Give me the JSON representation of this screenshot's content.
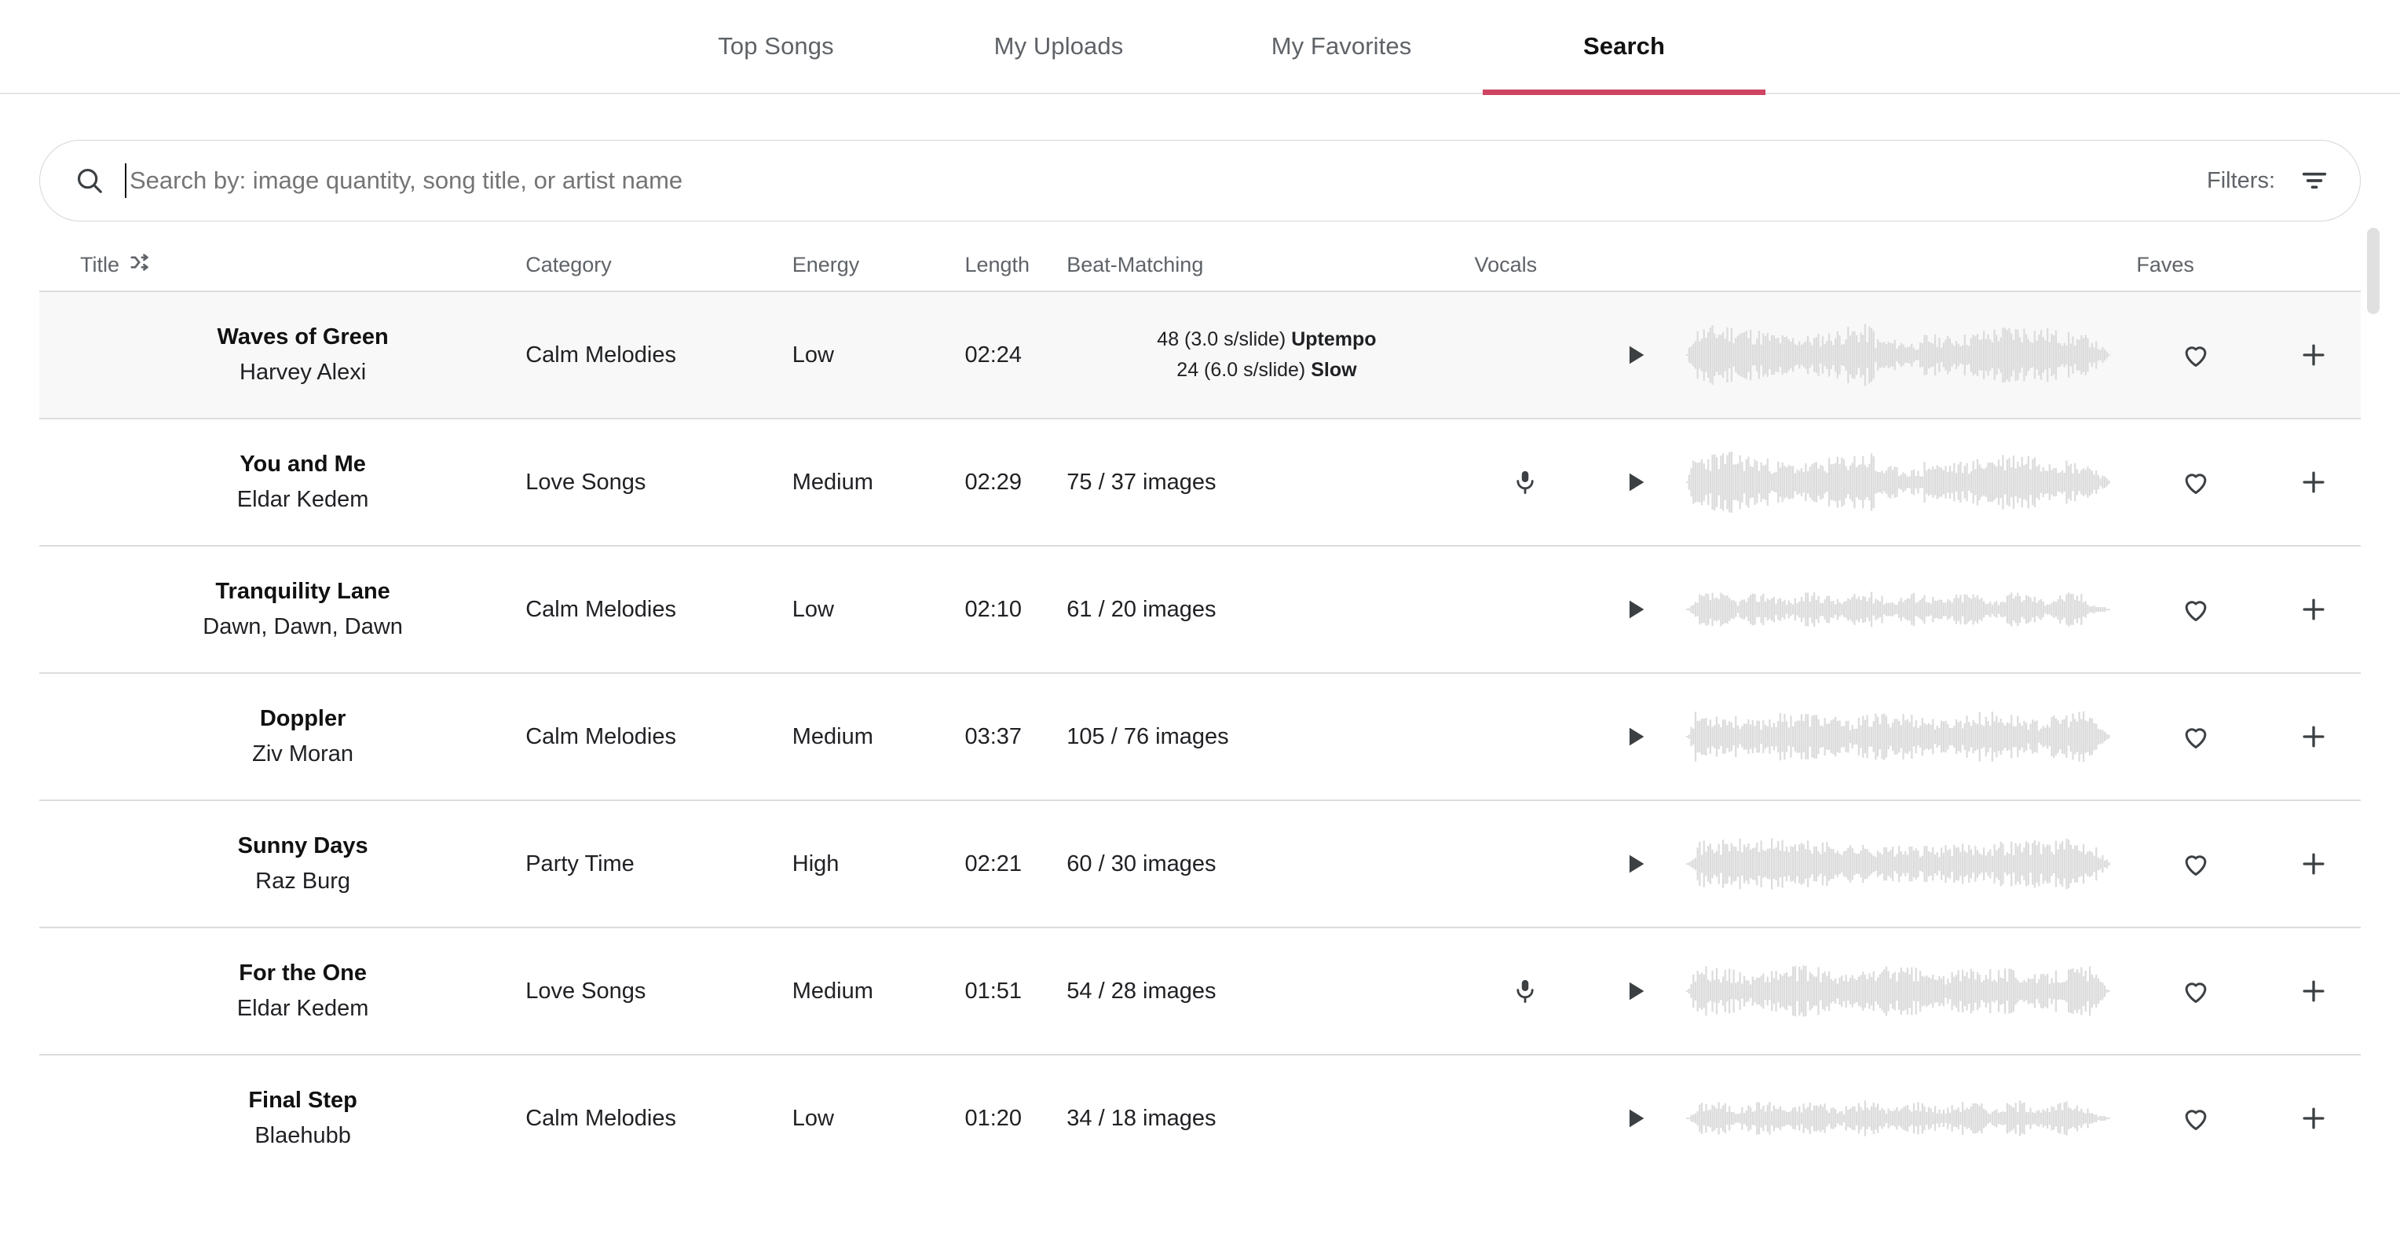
{
  "tabs": [
    {
      "label": "Top Songs",
      "active": false
    },
    {
      "label": "My Uploads",
      "active": false
    },
    {
      "label": "My Favorites",
      "active": false
    },
    {
      "label": "Search",
      "active": true
    }
  ],
  "accent_color": "#ce4461",
  "search": {
    "value": "",
    "placeholder": "Search by: image quantity, song title, or artist name",
    "icon": "search-icon",
    "filters_label": "Filters:",
    "filters_icon": "filter-icon"
  },
  "table": {
    "headers": {
      "title": "Title",
      "title_icon": "shuffle-icon",
      "category": "Category",
      "energy": "Energy",
      "length": "Length",
      "beat_matching": "Beat-Matching",
      "vocals": "Vocals",
      "faves": "Faves"
    },
    "rows": [
      {
        "title": "Waves of Green",
        "artist": "Harvey Alexi",
        "category": "Calm Melodies",
        "energy": "Low",
        "length": "02:24",
        "beat_lines": [
          {
            "text": "48 (3.0 s/slide) ",
            "bold": "Uptempo"
          },
          {
            "text": "24 (6.0 s/slide) ",
            "bold": "Slow"
          }
        ],
        "beat_text": "",
        "vocals": false,
        "highlight": true,
        "wave_seed": 11,
        "wave_style": "dense"
      },
      {
        "title": "You and Me",
        "artist": "Eldar Kedem",
        "category": "Love Songs",
        "energy": "Medium",
        "length": "02:29",
        "beat_lines": [],
        "beat_text": "75 / 37 images",
        "vocals": true,
        "highlight": false,
        "wave_seed": 23,
        "wave_style": "dense"
      },
      {
        "title": "Tranquility Lane",
        "artist": "Dawn, Dawn, Dawn",
        "category": "Calm Melodies",
        "energy": "Low",
        "length": "02:10",
        "beat_lines": [],
        "beat_text": "61 / 20 images",
        "vocals": false,
        "highlight": false,
        "wave_seed": 37,
        "wave_style": "sparse"
      },
      {
        "title": "Doppler",
        "artist": "Ziv Moran",
        "category": "Calm Melodies",
        "energy": "Medium",
        "length": "03:37",
        "beat_lines": [],
        "beat_text": "105 / 76 images",
        "vocals": false,
        "highlight": false,
        "wave_seed": 53,
        "wave_style": "medium"
      },
      {
        "title": "Sunny Days",
        "artist": "Raz Burg",
        "category": "Party Time",
        "energy": "High",
        "length": "02:21",
        "beat_lines": [],
        "beat_text": "60 / 30 images",
        "vocals": false,
        "highlight": false,
        "wave_seed": 71,
        "wave_style": "block"
      },
      {
        "title": "For the One",
        "artist": "Eldar Kedem",
        "category": "Love Songs",
        "energy": "Medium",
        "length": "01:51",
        "beat_lines": [],
        "beat_text": "54 / 28 images",
        "vocals": true,
        "highlight": false,
        "wave_seed": 89,
        "wave_style": "medium"
      },
      {
        "title": "Final Step",
        "artist": "Blaehubb",
        "category": "Calm Melodies",
        "energy": "Low",
        "length": "01:20",
        "beat_lines": [],
        "beat_text": "34 / 18 images",
        "vocals": false,
        "highlight": false,
        "wave_seed": 101,
        "wave_style": "sparse"
      }
    ]
  },
  "icons": {
    "play": "play-icon",
    "mic": "microphone-icon",
    "heart": "heart-icon",
    "plus": "plus-icon",
    "waveform": "waveform-icon"
  }
}
